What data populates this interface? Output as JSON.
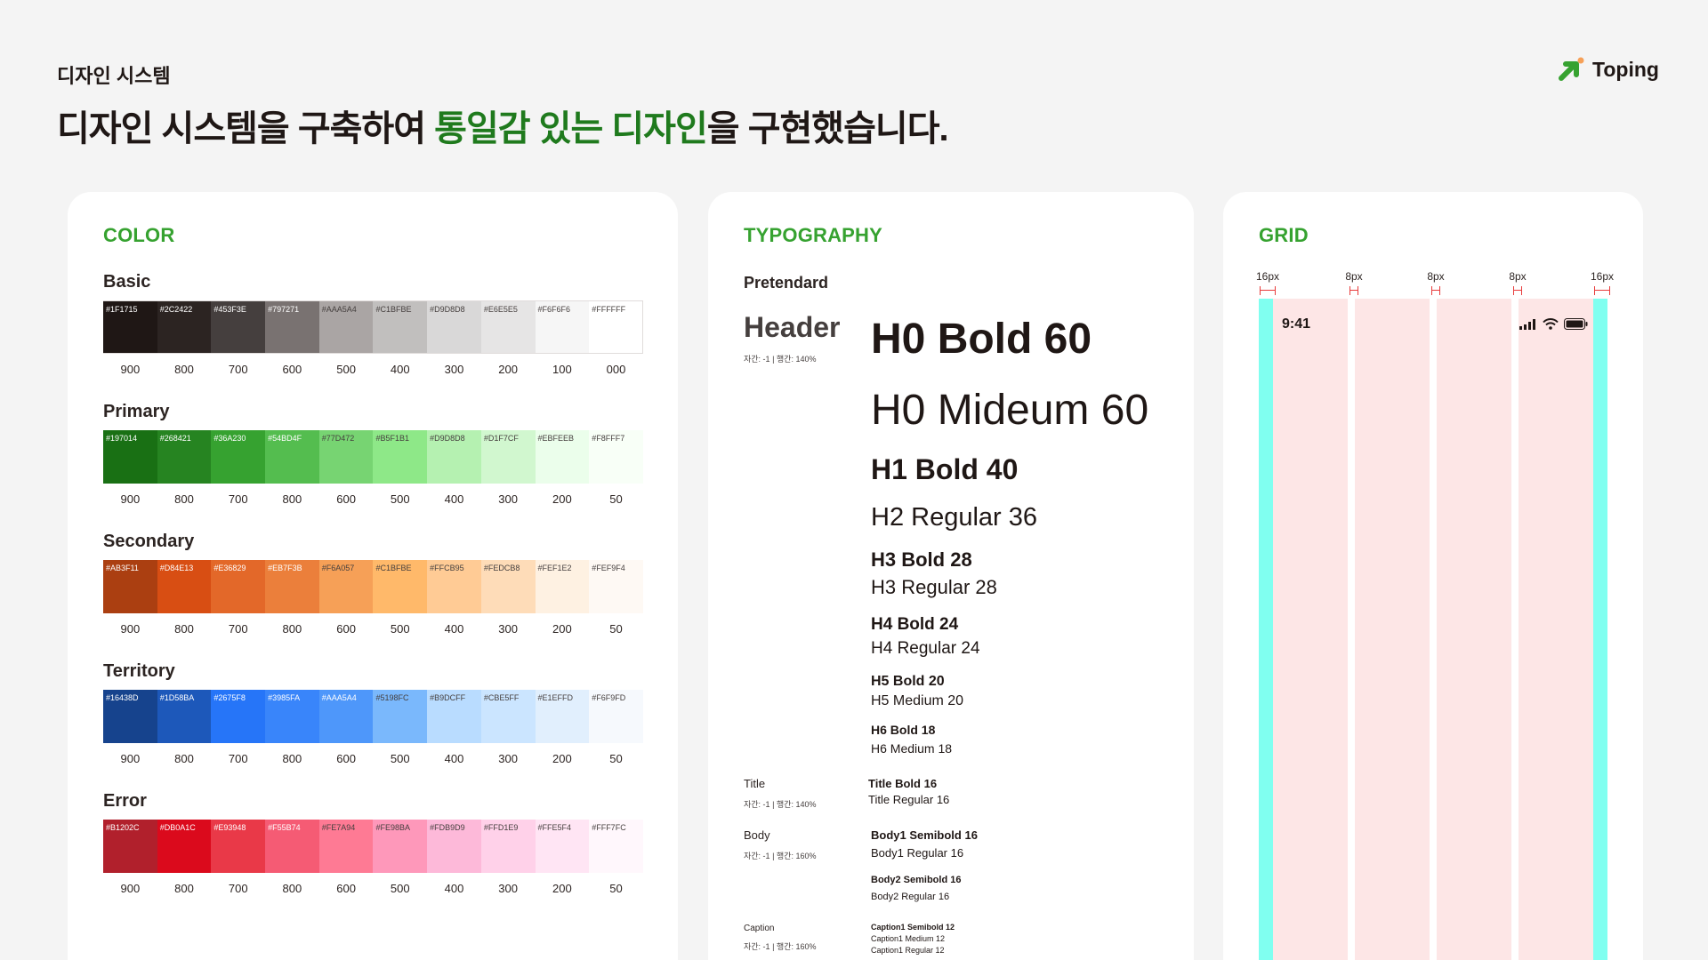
{
  "header": {
    "eyebrow": "디자인 시스템",
    "headline_part1": "디자인 시스템을 구축하여",
    "headline_highlight": "통일감 있는 디자인",
    "headline_part2": "을 구현했습니다.",
    "logo_text": "Toping",
    "highlight_color": "#1f7a1d"
  },
  "color": {
    "title": "COLOR",
    "palettes": [
      {
        "name": "Basic",
        "bordered": true,
        "swatches": [
          {
            "hex": "#1F1715",
            "shade": "900"
          },
          {
            "hex": "#2C2422",
            "shade": "800"
          },
          {
            "hex": "#453F3E",
            "shade": "700"
          },
          {
            "hex": "#797271",
            "shade": "600"
          },
          {
            "hex": "#AAA5A4",
            "shade": "500"
          },
          {
            "hex": "#C1BFBE",
            "shade": "400"
          },
          {
            "hex": "#D9D8D8",
            "shade": "300"
          },
          {
            "hex": "#E6E5E5",
            "shade": "200"
          },
          {
            "hex": "#F6F6F6",
            "shade": "100"
          },
          {
            "hex": "#FFFFFF",
            "shade": "000"
          }
        ]
      },
      {
        "name": "Primary",
        "swatches": [
          {
            "hex": "#197014",
            "shade": "900"
          },
          {
            "hex": "#268421",
            "shade": "800"
          },
          {
            "hex": "#36A230",
            "shade": "700"
          },
          {
            "hex": "#54BD4F",
            "shade": "800"
          },
          {
            "hex": "#77D472",
            "shade": "600"
          },
          {
            "hex": "#B5F1B1",
            "shade": "500"
          },
          {
            "hex": "#D9D8D8",
            "shade": "400"
          },
          {
            "hex": "#D1F7CF",
            "shade": "300"
          },
          {
            "hex": "#EBFEEB",
            "shade": "200"
          },
          {
            "hex": "#F8FFF7",
            "shade": "50"
          }
        ]
      },
      {
        "name": "Secondary",
        "swatches": [
          {
            "hex": "#AB3F11",
            "shade": "900"
          },
          {
            "hex": "#D84E13",
            "shade": "800"
          },
          {
            "hex": "#E36829",
            "shade": "700"
          },
          {
            "hex": "#EB7F3B",
            "shade": "800"
          },
          {
            "hex": "#F6A057",
            "shade": "600"
          },
          {
            "hex": "#C1BFBE",
            "shade": "500"
          },
          {
            "hex": "#FFCB95",
            "shade": "400"
          },
          {
            "hex": "#FEDCB8",
            "shade": "300"
          },
          {
            "hex": "#FEF1E2",
            "shade": "200"
          },
          {
            "hex": "#FEF9F4",
            "shade": "50"
          }
        ]
      },
      {
        "name": "Territory",
        "swatches": [
          {
            "hex": "#16438D",
            "shade": "900"
          },
          {
            "hex": "#1D58BA",
            "shade": "800"
          },
          {
            "hex": "#2675F8",
            "shade": "700"
          },
          {
            "hex": "#3985FA",
            "shade": "800"
          },
          {
            "hex": "#AAA5A4",
            "shade": "600"
          },
          {
            "hex": "#5198FC",
            "shade": "500"
          },
          {
            "hex": "#B9DCFF",
            "shade": "400"
          },
          {
            "hex": "#CBE5FF",
            "shade": "300"
          },
          {
            "hex": "#E1EFFD",
            "shade": "200"
          },
          {
            "hex": "#F6F9FD",
            "shade": "50"
          }
        ]
      },
      {
        "name": "Error",
        "swatches": [
          {
            "hex": "#B1202C",
            "shade": "900"
          },
          {
            "hex": "#DB0A1C",
            "shade": "800"
          },
          {
            "hex": "#E93948",
            "shade": "700"
          },
          {
            "hex": "#F55B74",
            "shade": "800"
          },
          {
            "hex": "#FE7A94",
            "shade": "600"
          },
          {
            "hex": "#FE98BA",
            "shade": "500"
          },
          {
            "hex": "#FDB9D9",
            "shade": "400"
          },
          {
            "hex": "#FFD1E9",
            "shade": "300"
          },
          {
            "hex": "#FFE5F4",
            "shade": "200"
          },
          {
            "hex": "#FFF7FC",
            "shade": "50"
          }
        ]
      }
    ],
    "display_fills": {
      "Basic": [
        "#1f1715",
        "#2c2422",
        "#453f3e",
        "#797271",
        "#aaa5a4",
        "#c1bfbe",
        "#d9d8d8",
        "#e6e5e5",
        "#f6f6f6",
        "#ffffff"
      ],
      "Primary": [
        "#197014",
        "#268421",
        "#36a230",
        "#54bd4f",
        "#77d472",
        "#8ee888",
        "#b5f1b1",
        "#d1f7cf",
        "#ebfeeb",
        "#f8fff7"
      ],
      "Secondary": [
        "#ab3f11",
        "#d84e13",
        "#e36829",
        "#eb7f3b",
        "#f6a057",
        "#ffb96a",
        "#ffcb95",
        "#fedcb8",
        "#fef1e2",
        "#fef9f4"
      ],
      "Territory": [
        "#16438d",
        "#1d58ba",
        "#2675f8",
        "#3985fa",
        "#4e97fa",
        "#7ab8fc",
        "#b9dcff",
        "#cbe5ff",
        "#e1effd",
        "#f6f9fd"
      ],
      "Error": [
        "#b1202c",
        "#db0a1c",
        "#e93948",
        "#f55b74",
        "#fe7a94",
        "#fe98ba",
        "#fdb9d9",
        "#ffd1e9",
        "#ffe5f4",
        "#fff7fc"
      ]
    }
  },
  "typography": {
    "title": "TYPOGRAPHY",
    "font": "Pretendard",
    "header_group": {
      "label": "Header",
      "meta": "자간: -1  |  행간: 140%"
    },
    "title_group": {
      "label": "Title",
      "meta": "자간: -1  |  행간: 140%"
    },
    "body_group": {
      "label": "Body",
      "meta": "자간: -1  |  행간: 160%"
    },
    "caption_group": {
      "label": "Caption",
      "meta": "자간: -1  |  행간: 160%"
    },
    "styles": {
      "h0_bold": "H0 Bold 60",
      "h0_medium": "H0 Mideum 60",
      "h1_bold": "H1 Bold 40",
      "h2_regular": "H2 Regular 36",
      "h3_bold": "H3 Bold 28",
      "h3_regular": "H3 Regular 28",
      "h4_bold": "H4 Bold 24",
      "h4_regular": "H4 Regular 24",
      "h5_bold": "H5 Bold 20",
      "h5_medium": "H5 Medium 20",
      "h6_bold": "H6 Bold 18",
      "h6_medium": "H6 Medium 18",
      "title_bold": "Title Bold 16",
      "title_regular": "Title Regular 16",
      "body1_semibold": "Body1 Semibold 16",
      "body1_regular": "Body1 Regular 16",
      "body2_semibold": "Body2 Semibold 16",
      "body2_regular": "Body2 Regular 16",
      "caption1_semibold": "Caption1 Semibold 12",
      "caption1_medium": "Caption1 Medium 12",
      "caption1_regular": "Caption1 Regular 12"
    }
  },
  "grid": {
    "title": "GRID",
    "labels": [
      "16px",
      "8px",
      "8px",
      "8px",
      "16px"
    ],
    "status_time": "9:41",
    "colors": {
      "margin": "#80fff0",
      "column": "#fde6e6",
      "marker": "#e83b3b"
    }
  }
}
